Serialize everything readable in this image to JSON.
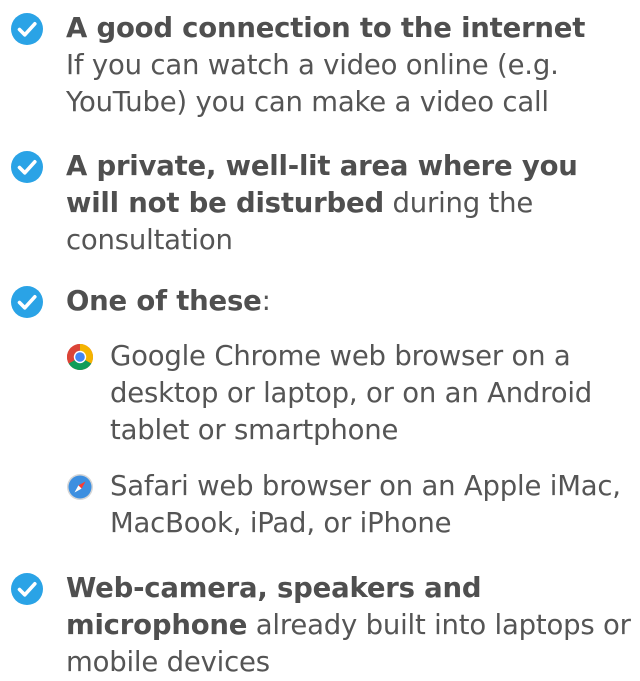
{
  "colors": {
    "check": "#2aa3e6",
    "text": "#555555"
  },
  "items": [
    {
      "icon": "checkmark-circle-icon",
      "bold": "A good connection to the internet",
      "text": "If you can watch a video online (e.g. YouTube) you can make a video call"
    },
    {
      "icon": "checkmark-circle-icon",
      "bold": "A private, well-lit area where you will not be disturbed",
      "text": " during the consultation"
    },
    {
      "icon": "checkmark-circle-icon",
      "bold": "One of these",
      "text": ":",
      "sub": [
        {
          "icon": "chrome-icon",
          "text": "Google Chrome web browser on a desktop or laptop, or on an Android tablet or smartphone"
        },
        {
          "icon": "safari-icon",
          "text": "Safari web browser on an Apple iMac, MacBook, iPad, or iPhone"
        }
      ]
    },
    {
      "icon": "checkmark-circle-icon",
      "bold": "Web-camera, speakers and microphone",
      "text": " already built into laptops or mobile devices"
    }
  ]
}
